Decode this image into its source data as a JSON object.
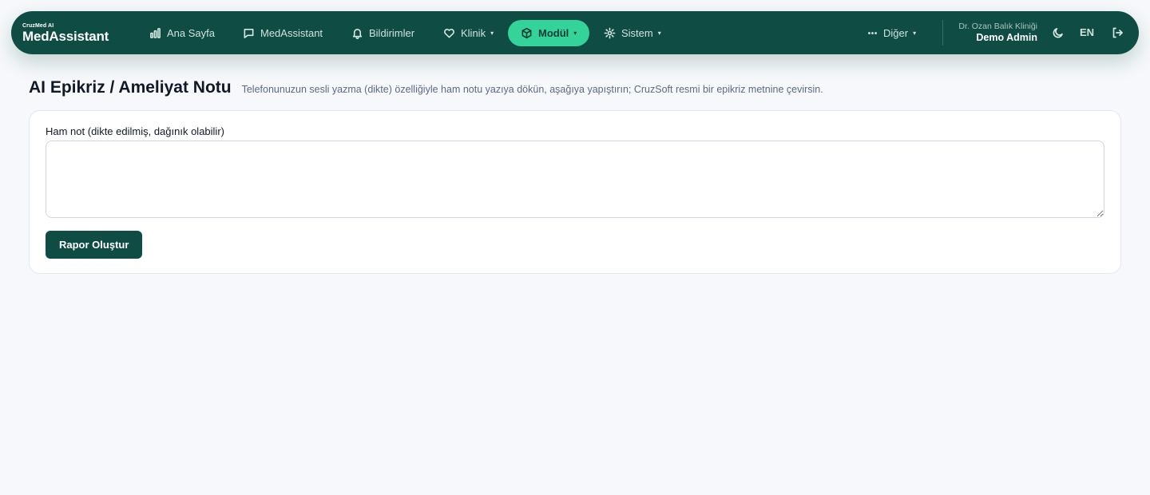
{
  "brand": {
    "top": "CruzMed AI",
    "name": "MedAssistant"
  },
  "nav": {
    "items": [
      {
        "label": "Ana Sayfa",
        "icon": "bar-chart-icon",
        "has_caret": false,
        "active": false
      },
      {
        "label": "MedAssistant",
        "icon": "chat-icon",
        "has_caret": false,
        "active": false
      },
      {
        "label": "Bildirimler",
        "icon": "bell-icon",
        "has_caret": false,
        "active": false
      },
      {
        "label": "Klinik",
        "icon": "heart-icon",
        "has_caret": true,
        "active": false
      },
      {
        "label": "Modül",
        "icon": "cube-icon",
        "has_caret": true,
        "active": true
      },
      {
        "label": "Sistem",
        "icon": "gear-icon",
        "has_caret": true,
        "active": false
      }
    ],
    "more": {
      "label": "Diğer",
      "icon": "ellipsis-icon"
    },
    "caret": "▾"
  },
  "user": {
    "clinic": "Dr. Ozan Balık Kliniği",
    "name": "Demo Admin"
  },
  "actions": {
    "theme_icon": "moon-icon",
    "language": "EN",
    "logout_icon": "logout-icon"
  },
  "page": {
    "title": "AI Epikriz / Ameliyat Notu",
    "subtitle": "Telefonunuzun sesli yazma (dikte) özelliğiyle ham notu yazıya dökün, aşağıya yapıştırın; CruzSoft resmi bir epikriz metnine çevirsin."
  },
  "form": {
    "label": "Ham not (dikte edilmiş, dağınık olabilir)",
    "value": "",
    "placeholder": "",
    "submit_label": "Rapor Oluştur"
  },
  "colors": {
    "nav_bg": "#0f4c43",
    "accent": "#34d399",
    "page_bg": "#f6f8fb",
    "button_bg": "#0f4c43"
  }
}
